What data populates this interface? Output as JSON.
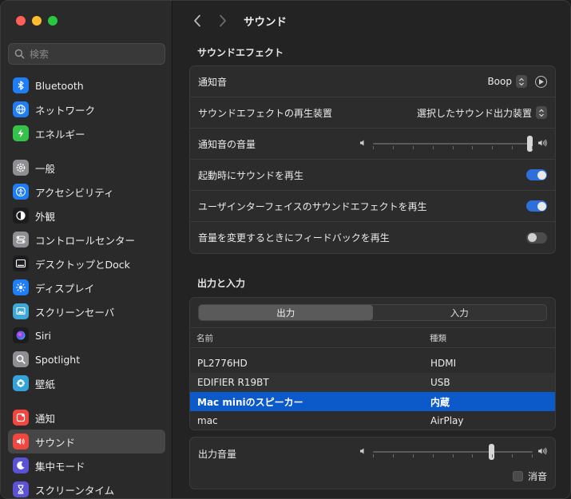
{
  "sidebar": {
    "search_placeholder": "検索",
    "items": [
      {
        "label": "Bluetooth",
        "icon": "bluetooth-icon",
        "color": "#1f7ef5"
      },
      {
        "label": "ネットワーク",
        "icon": "globe-icon",
        "color": "#1f7ef5"
      },
      {
        "label": "エネルギー",
        "icon": "battery-bolt-icon",
        "color": "#35c24a"
      },
      {
        "label": "一般",
        "icon": "gear-icon",
        "color": "#8e8e93"
      },
      {
        "label": "アクセシビリティ",
        "icon": "accessibility-icon",
        "color": "#1f7ef5"
      },
      {
        "label": "外観",
        "icon": "appearance-icon",
        "color": "#1c1c1e"
      },
      {
        "label": "コントロールセンター",
        "icon": "control-center-icon",
        "color": "#8e8e93"
      },
      {
        "label": "デスクトップとDock",
        "icon": "dock-icon",
        "color": "#1c1c1e"
      },
      {
        "label": "ディスプレイ",
        "icon": "sun-icon",
        "color": "#1f7ef5"
      },
      {
        "label": "スクリーンセーバ",
        "icon": "screensaver-icon",
        "color": "#3ca9d8"
      },
      {
        "label": "Siri",
        "icon": "siri-icon",
        "color": "#1c1c1e"
      },
      {
        "label": "Spotlight",
        "icon": "magnifier-icon",
        "color": "#8e8e93"
      },
      {
        "label": "壁紙",
        "icon": "wallpaper-icon",
        "color": "#33a3dc"
      },
      {
        "label": "通知",
        "icon": "bell-icon",
        "color": "#f2473e"
      },
      {
        "label": "サウンド",
        "icon": "speaker-icon",
        "color": "#f2473e"
      },
      {
        "label": "集中モード",
        "icon": "moon-icon",
        "color": "#5b52d6"
      },
      {
        "label": "スクリーンタイム",
        "icon": "hourglass-icon",
        "color": "#5b52d6"
      }
    ]
  },
  "header": {
    "title": "サウンド"
  },
  "sound_effects": {
    "title": "サウンドエフェクト",
    "alert_sound_label": "通知音",
    "alert_sound_value": "Boop",
    "output_device_label": "サウンドエフェクトの再生装置",
    "output_device_value": "選択したサウンド出力装置",
    "alert_volume_label": "通知音の音量",
    "alert_volume_level": 1.0,
    "startup_label": "起動時にサウンドを再生",
    "startup_on": true,
    "ui_effects_label": "ユーザインターフェイスのサウンドエフェクトを再生",
    "ui_effects_on": true,
    "feedback_label": "音量を変更するときにフィードバックを再生",
    "feedback_on": false
  },
  "output_input": {
    "title": "出力と入力",
    "tab_output": "出力",
    "tab_input": "入力",
    "col_name": "名前",
    "col_type": "種類",
    "devices": [
      {
        "name": "PL2776HD",
        "type": "HDMI"
      },
      {
        "name": "EDIFIER R19BT",
        "type": "USB"
      },
      {
        "name": "Mac miniのスピーカー",
        "type": "内蔵",
        "selected": true
      },
      {
        "name": "mac",
        "type": "AirPlay"
      }
    ],
    "output_volume_label": "出力音量",
    "output_volume_level": 0.75,
    "mute_label": "消音"
  }
}
